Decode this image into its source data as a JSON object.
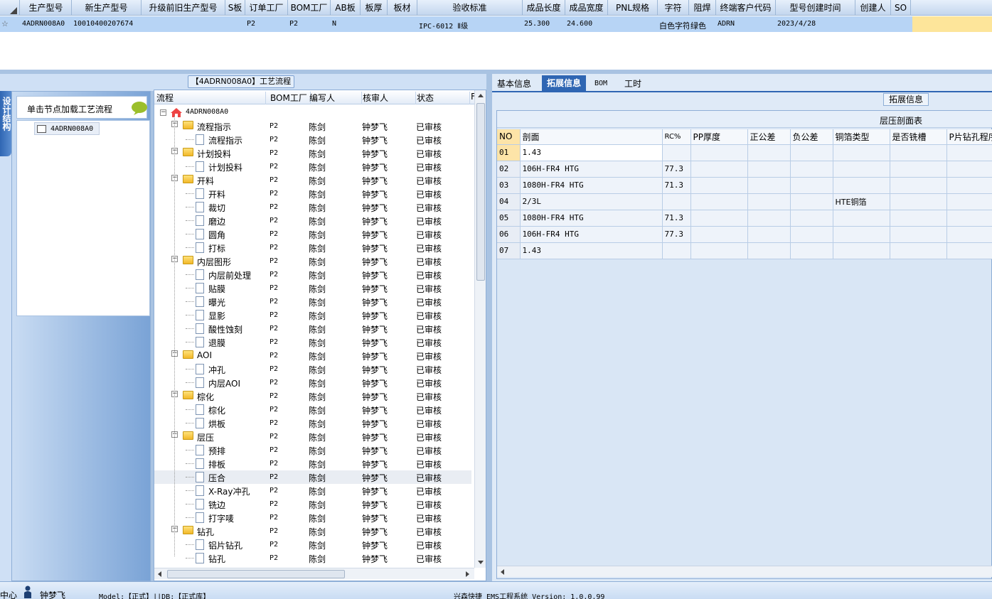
{
  "top_grid": {
    "headers": [
      "生产型号",
      "新生产型号",
      "升级前旧生产型号",
      "S板",
      "订单工厂",
      "BOM工厂",
      "AB板",
      "板厚",
      "板材",
      "验收标准",
      "成品长度",
      "成品宽度",
      "PNL规格",
      "字符",
      "阻焊",
      "终端客户代码",
      "型号创建时间",
      "创建人",
      "SO"
    ],
    "row": [
      "4ADRN008A0",
      "10010400207674",
      "",
      "",
      "P2",
      "P2",
      "N",
      "",
      "",
      "IPC-6012 Ⅱ级",
      "25.300",
      "24.600",
      "",
      "白色字符",
      "绿色",
      "ADRN",
      "2023/4/28",
      "",
      ""
    ]
  },
  "left_panel": {
    "tab_label": "设计结构",
    "hint": "单击节点加载工艺流程",
    "node": "4ADRN008A0"
  },
  "flow_panel": {
    "title": "【4ADRN008A0】工艺流程",
    "headers": [
      "流程",
      "BOM工厂",
      "编写人",
      "核审人",
      "状态",
      "F"
    ],
    "root": "4ADRN008A0",
    "rows": [
      {
        "level": 1,
        "name": "流程指示",
        "bom": "P2",
        "writer": "陈剑",
        "reviewer": "钟梦飞",
        "status": "已审核"
      },
      {
        "level": 2,
        "name": "流程指示",
        "bom": "P2",
        "writer": "陈剑",
        "reviewer": "钟梦飞",
        "status": "已审核"
      },
      {
        "level": 1,
        "name": "计划投料",
        "bom": "P2",
        "writer": "陈剑",
        "reviewer": "钟梦飞",
        "status": "已审核"
      },
      {
        "level": 2,
        "name": "计划投料",
        "bom": "P2",
        "writer": "陈剑",
        "reviewer": "钟梦飞",
        "status": "已审核"
      },
      {
        "level": 1,
        "name": "开料",
        "bom": "P2",
        "writer": "陈剑",
        "reviewer": "钟梦飞",
        "status": "已审核"
      },
      {
        "level": 2,
        "name": "开料",
        "bom": "P2",
        "writer": "陈剑",
        "reviewer": "钟梦飞",
        "status": "已审核"
      },
      {
        "level": 2,
        "name": "裁切",
        "bom": "P2",
        "writer": "陈剑",
        "reviewer": "钟梦飞",
        "status": "已审核"
      },
      {
        "level": 2,
        "name": "磨边",
        "bom": "P2",
        "writer": "陈剑",
        "reviewer": "钟梦飞",
        "status": "已审核"
      },
      {
        "level": 2,
        "name": "圆角",
        "bom": "P2",
        "writer": "陈剑",
        "reviewer": "钟梦飞",
        "status": "已审核"
      },
      {
        "level": 2,
        "name": "打标",
        "bom": "P2",
        "writer": "陈剑",
        "reviewer": "钟梦飞",
        "status": "已审核"
      },
      {
        "level": 1,
        "name": "内层图形",
        "bom": "P2",
        "writer": "陈剑",
        "reviewer": "钟梦飞",
        "status": "已审核"
      },
      {
        "level": 2,
        "name": "内层前处理",
        "bom": "P2",
        "writer": "陈剑",
        "reviewer": "钟梦飞",
        "status": "已审核"
      },
      {
        "level": 2,
        "name": "贴膜",
        "bom": "P2",
        "writer": "陈剑",
        "reviewer": "钟梦飞",
        "status": "已审核"
      },
      {
        "level": 2,
        "name": "曝光",
        "bom": "P2",
        "writer": "陈剑",
        "reviewer": "钟梦飞",
        "status": "已审核"
      },
      {
        "level": 2,
        "name": "显影",
        "bom": "P2",
        "writer": "陈剑",
        "reviewer": "钟梦飞",
        "status": "已审核"
      },
      {
        "level": 2,
        "name": "酸性蚀刻",
        "bom": "P2",
        "writer": "陈剑",
        "reviewer": "钟梦飞",
        "status": "已审核"
      },
      {
        "level": 2,
        "name": "退膜",
        "bom": "P2",
        "writer": "陈剑",
        "reviewer": "钟梦飞",
        "status": "已审核"
      },
      {
        "level": 1,
        "name": "AOI",
        "bom": "P2",
        "writer": "陈剑",
        "reviewer": "钟梦飞",
        "status": "已审核"
      },
      {
        "level": 2,
        "name": "冲孔",
        "bom": "P2",
        "writer": "陈剑",
        "reviewer": "钟梦飞",
        "status": "已审核"
      },
      {
        "level": 2,
        "name": "内层AOI",
        "bom": "P2",
        "writer": "陈剑",
        "reviewer": "钟梦飞",
        "status": "已审核"
      },
      {
        "level": 1,
        "name": "棕化",
        "bom": "P2",
        "writer": "陈剑",
        "reviewer": "钟梦飞",
        "status": "已审核"
      },
      {
        "level": 2,
        "name": "棕化",
        "bom": "P2",
        "writer": "陈剑",
        "reviewer": "钟梦飞",
        "status": "已审核"
      },
      {
        "level": 2,
        "name": "烘板",
        "bom": "P2",
        "writer": "陈剑",
        "reviewer": "钟梦飞",
        "status": "已审核"
      },
      {
        "level": 1,
        "name": "层压",
        "bom": "P2",
        "writer": "陈剑",
        "reviewer": "钟梦飞",
        "status": "已审核"
      },
      {
        "level": 2,
        "name": "预排",
        "bom": "P2",
        "writer": "陈剑",
        "reviewer": "钟梦飞",
        "status": "已审核"
      },
      {
        "level": 2,
        "name": "排板",
        "bom": "P2",
        "writer": "陈剑",
        "reviewer": "钟梦飞",
        "status": "已审核"
      },
      {
        "level": 2,
        "name": "压合",
        "bom": "P2",
        "writer": "陈剑",
        "reviewer": "钟梦飞",
        "status": "已审核",
        "selected": true
      },
      {
        "level": 2,
        "name": "X-Ray冲孔",
        "bom": "P2",
        "writer": "陈剑",
        "reviewer": "钟梦飞",
        "status": "已审核"
      },
      {
        "level": 2,
        "name": "铣边",
        "bom": "P2",
        "writer": "陈剑",
        "reviewer": "钟梦飞",
        "status": "已审核"
      },
      {
        "level": 2,
        "name": "打字唛",
        "bom": "P2",
        "writer": "陈剑",
        "reviewer": "钟梦飞",
        "status": "已审核"
      },
      {
        "level": 1,
        "name": "钻孔",
        "bom": "P2",
        "writer": "陈剑",
        "reviewer": "钟梦飞",
        "status": "已审核"
      },
      {
        "level": 2,
        "name": "铝片钻孔",
        "bom": "P2",
        "writer": "陈剑",
        "reviewer": "钟梦飞",
        "status": "已审核"
      },
      {
        "level": 2,
        "name": "钻孔",
        "bom": "P2",
        "writer": "陈剑",
        "reviewer": "钟梦飞",
        "status": "已审核"
      }
    ]
  },
  "right_panel": {
    "tabs": [
      "基本信息",
      "拓展信息",
      "BOM",
      "工时"
    ],
    "active_tab": 1,
    "group_label": "拓展信息",
    "table_title": "层压剖面表",
    "headers": [
      "NO",
      "剖面",
      "RC%",
      "PP厚度",
      "正公差",
      "负公差",
      "铜箔类型",
      "是否铣槽",
      "P片钻孔程序"
    ],
    "rows": [
      [
        "01",
        "1.43",
        "",
        "",
        "",
        "",
        "",
        "",
        ""
      ],
      [
        "02",
        "106H-FR4 HTG",
        "77.3",
        "",
        "",
        "",
        "",
        "",
        ""
      ],
      [
        "03",
        "1080H-FR4 HTG",
        "71.3",
        "",
        "",
        "",
        "",
        "",
        ""
      ],
      [
        "04",
        "2/3L",
        "",
        "",
        "",
        "",
        "HTE铜箔",
        "",
        ""
      ],
      [
        "05",
        "1080H-FR4 HTG",
        "71.3",
        "",
        "",
        "",
        "",
        "",
        ""
      ],
      [
        "06",
        "106H-FR4 HTG",
        "77.3",
        "",
        "",
        "",
        "",
        "",
        ""
      ],
      [
        "07",
        "1.43",
        "",
        "",
        "",
        "",
        "",
        "",
        ""
      ]
    ]
  },
  "status_bar": {
    "left": "中心",
    "user": "钟梦飞",
    "model": "Model:【正式】||DB:【正式库】",
    "app": "兴森快捷 EMS工程系统 Version: 1.0.0.99"
  },
  "colors": {
    "header_bg": "#d6e4f5",
    "selected_row": "#b5d3f7",
    "accent_tab": "#2f66b3",
    "panel_bg": "#dfeaf7"
  }
}
